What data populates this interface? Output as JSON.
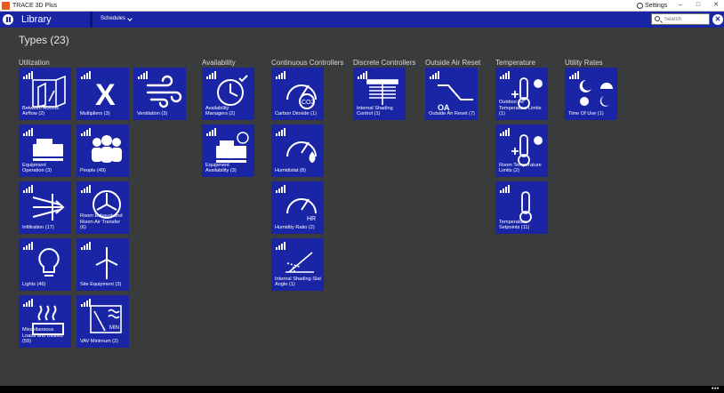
{
  "window": {
    "title": "TRACE 3D Plus",
    "settings_label": "Settings",
    "minimize": "–",
    "maximize": "□",
    "close": "✕"
  },
  "header": {
    "title": "Library",
    "schedules_label": "Schedules",
    "search_placeholder": "Search",
    "close_glyph": "✕"
  },
  "page": {
    "title": "Types (23)"
  },
  "categories": [
    {
      "name": "Utilization"
    },
    {
      "name": "Availability"
    },
    {
      "name": "Continuous Controllers"
    },
    {
      "name": "Discrete Controllers"
    },
    {
      "name": "Outside Air Reset"
    },
    {
      "name": "Temperature"
    },
    {
      "name": "Utility Rates"
    }
  ],
  "tiles": [
    {
      "label": "Between Rooms Airflow (2)",
      "icon": "doors-icon"
    },
    {
      "label": "Multipliers (3)",
      "icon": "multiply-icon"
    },
    {
      "label": "Ventilation (3)",
      "icon": "wind-icon"
    },
    {
      "label": "Equipment Operation (3)",
      "icon": "equipment-icon"
    },
    {
      "label": "People (49)",
      "icon": "people-icon"
    },
    {
      "label": "Infiltration (17)",
      "icon": "infiltration-icon"
    },
    {
      "label": "Room Exhaust and Room Air Transfer (6)",
      "icon": "exhaust-fan-icon"
    },
    {
      "label": "Lights (46)",
      "icon": "lightbulb-icon"
    },
    {
      "label": "Site Equipment (3)",
      "icon": "wind-turbine-icon"
    },
    {
      "label": "Miscellaneous Loads and Utilities (59)",
      "icon": "heat-plate-icon"
    },
    {
      "label": "VAV Minimum (2)",
      "icon": "vav-min-icon"
    },
    {
      "label": "Availability Managers (2)",
      "icon": "clock-check-icon"
    },
    {
      "label": "Equipment Availability (3)",
      "icon": "equipment-clock-icon"
    },
    {
      "label": "Carbon Dioxide (1)",
      "icon": "co2-gauge-icon"
    },
    {
      "label": "Humidistat (8)",
      "icon": "humidistat-gauge-icon"
    },
    {
      "label": "Humidity Ratio (2)",
      "icon": "humidity-ratio-gauge-icon"
    },
    {
      "label": "Internal Shading Slat Angle (1)",
      "icon": "slat-angle-icon"
    },
    {
      "label": "Internal Shading Control (1)",
      "icon": "blinds-icon"
    },
    {
      "label": "Outside Air Reset (7)",
      "icon": "oa-reset-curve-icon"
    },
    {
      "label": "Outdoor Air Temperature Limits (1)",
      "icon": "oa-temp-limits-icon"
    },
    {
      "label": "Room Temperature Limits (2)",
      "icon": "room-temp-limits-icon"
    },
    {
      "label": "Temperature Setpoints (11)",
      "icon": "thermometer-icon"
    },
    {
      "label": "Time Of Use (1)",
      "icon": "day-night-icon"
    }
  ],
  "colors": {
    "tile_bg": "#1a25a6",
    "page_bg": "#3a3b3c",
    "header_bg": "#1a25a6"
  }
}
